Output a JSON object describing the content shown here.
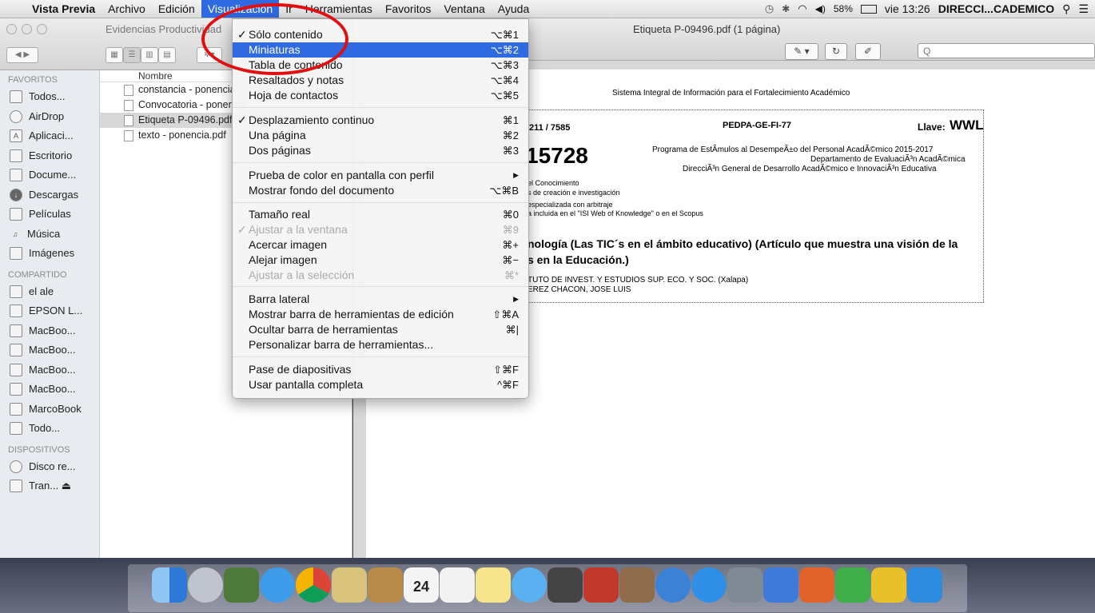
{
  "menubar": {
    "app": "Vista Previa",
    "items": [
      "Archivo",
      "Edición",
      "Visualización",
      "Ir",
      "Herramientas",
      "Favoritos",
      "Ventana",
      "Ayuda"
    ],
    "active": "Visualización",
    "battery": "58%",
    "clock": "vie 13:26",
    "user": "DIRECCI...CADEMICO"
  },
  "finder": {
    "title": "Evidencias Productividad",
    "column_header": "Nombre",
    "favorites_heading": "FAVORITOS",
    "favorites": [
      "Todos...",
      "AirDrop",
      "Aplicaci...",
      "Escritorio",
      "Docume...",
      "Descargas",
      "Películas",
      "Música",
      "Imágenes"
    ],
    "shared_heading": "COMPARTIDO",
    "shared": [
      "el ale",
      "EPSON L...",
      "MacBoo...",
      "MacBoo...",
      "MacBoo...",
      "MacBoo...",
      "MarcoBook",
      "Todo..."
    ],
    "devices_heading": "DISPOSITIVOS",
    "devices": [
      "Disco re...",
      "Tran... ⏏"
    ],
    "files": [
      "constancia - ponencia",
      "Convocatoria - ponencia",
      "Etiqueta P-09496.pdf",
      "texto - ponencia.pdf"
    ],
    "selected_file": "Etiqueta P-09496.pdf"
  },
  "preview": {
    "title": "Etiqueta P-09496.pdf (1 página)",
    "search_placeholder": "Q",
    "doc": {
      "system": "Sistema Integral de Información para el Fortalecimiento Académico",
      "ref": "211 / 7585",
      "code": "PEDPA-GE-FI-77",
      "key_label": "Llave:",
      "key_value": "WWL",
      "bignum": "15728",
      "program": "Programa de EstÃmulos al DesempeÃ±o del Personal AcadÃ©mico 2015-2017",
      "dept": "Departamento de EvaluaciÃ³n AcadÃ©mica",
      "direccion": "DirecciÃ³n General de Desarrollo AcadÃ©mico e InnovaciÃ³n Educativa",
      "line1": "el Conocimiento",
      "line2": "s de creación e investigación",
      "line3": "especializada con arbitraje",
      "line4": "a incluida en el \"ISI Web of Knowledge\" o en el Scopus",
      "title1": "nología (Las TIC´s en el ámbito educativo) (Artículo que muestra una visión de la",
      "title2": "s en la Educación.)",
      "inst": "TUTO DE INVEST. Y ESTUDIOS SUP. ECO. Y SOC. (Xalapa)",
      "author": "EREZ CHACON, JOSE LUIS"
    }
  },
  "menu": {
    "items": [
      {
        "label": "Sólo contenido",
        "shortcut": "⌥⌘1",
        "checked": true
      },
      {
        "label": "Miniaturas",
        "shortcut": "⌥⌘2",
        "selected": true
      },
      {
        "label": "Tabla de contenido",
        "shortcut": "⌥⌘3"
      },
      {
        "label": "Resaltados y notas",
        "shortcut": "⌥⌘4"
      },
      {
        "label": "Hoja de contactos",
        "shortcut": "⌥⌘5"
      },
      {
        "label": "Desplazamiento continuo",
        "shortcut": "⌘1",
        "checked": true
      },
      {
        "label": "Una página",
        "shortcut": "⌘2"
      },
      {
        "label": "Dos páginas",
        "shortcut": "⌘3"
      },
      {
        "label": "Prueba de color en pantalla con perfil",
        "shortcut": "▶"
      },
      {
        "label": "Mostrar fondo del documento",
        "shortcut": "⌥⌘B"
      },
      {
        "label": "Tamaño real",
        "shortcut": "⌘0"
      },
      {
        "label": "Ajustar a la ventana",
        "shortcut": "⌘9",
        "checked": true,
        "disabled": true
      },
      {
        "label": "Acercar imagen",
        "shortcut": "⌘+"
      },
      {
        "label": "Alejar imagen",
        "shortcut": "⌘−"
      },
      {
        "label": "Ajustar a la selección",
        "shortcut": "⌘*",
        "disabled": true
      },
      {
        "label": "Barra lateral",
        "shortcut": "▶"
      },
      {
        "label": "Mostrar barra de herramientas de edición",
        "shortcut": "⇧⌘A"
      },
      {
        "label": "Ocultar barra de herramientas",
        "shortcut": "⌘|"
      },
      {
        "label": "Personalizar barra de herramientas...",
        "shortcut": ""
      },
      {
        "label": "Pase de diapositivas",
        "shortcut": "⇧⌘F"
      },
      {
        "label": "Usar pantalla completa",
        "shortcut": "^⌘F"
      }
    ]
  },
  "dock": {
    "icons": [
      "finder-icon",
      "launchpad-icon",
      "app-icon",
      "safari-icon",
      "chrome-icon",
      "preview-icon",
      "contacts-icon",
      "calendar-icon",
      "reminders-icon",
      "notes-icon",
      "messages-icon",
      "facetime-icon",
      "photobooth-icon",
      "iphoto-icon",
      "itunes-icon",
      "appstore-icon",
      "settings-icon",
      "word-icon",
      "powerpoint-icon",
      "excel-icon",
      "onenote-icon",
      "lync-icon",
      "skype-icon",
      "app2-icon",
      "photos-icon",
      "folder-icon",
      "folder2-icon",
      "folder3-icon",
      "folder4-icon",
      "trash-icon"
    ],
    "calendar_day": "24"
  }
}
